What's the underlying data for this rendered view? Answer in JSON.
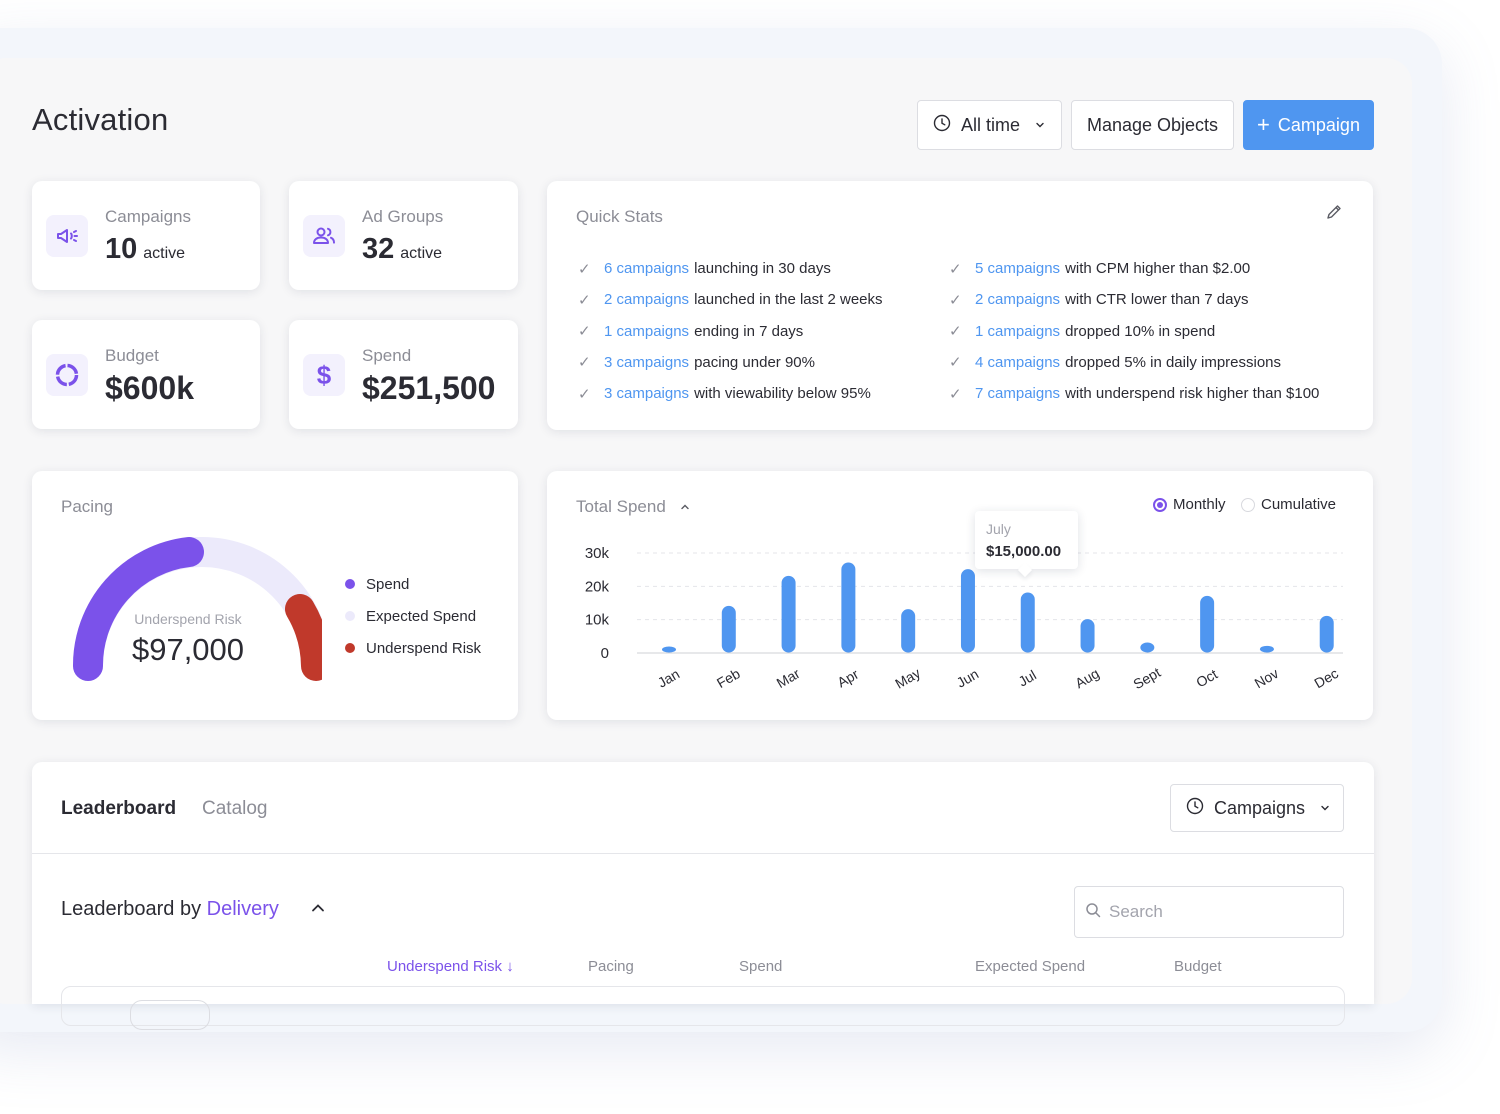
{
  "page": {
    "title": "Activation"
  },
  "toolbar": {
    "time_filter": "All time",
    "manage_objects": "Manage Objects",
    "add_campaign": "Campaign"
  },
  "stats": {
    "campaigns": {
      "label": "Campaigns",
      "value": "10",
      "sub": "active"
    },
    "ad_groups": {
      "label": "Ad Groups",
      "value": "32",
      "sub": "active"
    },
    "budget": {
      "label": "Budget",
      "value": "$600k"
    },
    "spend": {
      "label": "Spend",
      "value": "$251,500"
    }
  },
  "quick_stats": {
    "title": "Quick Stats",
    "left": [
      {
        "link": "6 campaigns",
        "text": "launching in 30 days"
      },
      {
        "link": "2 campaigns",
        "text": "launched in the last 2 weeks"
      },
      {
        "link": "1 campaigns",
        "text": "ending in 7 days"
      },
      {
        "link": "3 campaigns",
        "text": "pacing under 90%"
      },
      {
        "link": "3 campaigns",
        "text": "with viewability below 95%"
      }
    ],
    "right": [
      {
        "link": "5 campaigns",
        "text": "with CPM higher than $2.00"
      },
      {
        "link": "2 campaigns",
        "text": "with CTR lower than 7 days"
      },
      {
        "link": "1 campaigns",
        "text": "dropped 10% in spend"
      },
      {
        "link": "4 campaigns",
        "text": "dropped 5% in daily impressions"
      },
      {
        "link": "7 campaigns",
        "text": "with underspend risk higher than $100"
      }
    ]
  },
  "pacing": {
    "title": "Pacing",
    "center_label": "Underspend Risk",
    "center_value": "$97,000",
    "legend": [
      {
        "label": "Spend",
        "color": "#7b52ea"
      },
      {
        "label": "Expected Spend",
        "color": "#eceafb"
      },
      {
        "label": "Underspend Risk",
        "color": "#c0392b"
      }
    ]
  },
  "total_spend": {
    "title": "Total Spend",
    "toggle_monthly": "Monthly",
    "toggle_cumulative": "Cumulative",
    "tooltip_month": "July",
    "tooltip_value": "$15,000.00"
  },
  "chart_data": {
    "type": "bar",
    "categories": [
      "Jan",
      "Feb",
      "Mar",
      "Apr",
      "May",
      "Jun",
      "Jul",
      "Aug",
      "Sept",
      "Oct",
      "Nov",
      "Dec"
    ],
    "values": [
      1000,
      14000,
      23000,
      27000,
      13000,
      25000,
      18000,
      10000,
      3000,
      17000,
      2000,
      11000
    ],
    "y_ticks": [
      "30k",
      "20k",
      "10k",
      "0"
    ],
    "ylim": [
      0,
      30000
    ],
    "grid": true,
    "color": "#4f96f0"
  },
  "leaderboard": {
    "tab_leaderboard": "Leaderboard",
    "tab_catalog": "Catalog",
    "dropdown": "Campaigns",
    "title_prefix": "Leaderboard by",
    "title_accent": "Delivery",
    "search_placeholder": "Search",
    "columns": [
      "Underspend Risk",
      "Pacing",
      "Spend",
      "Expected Spend",
      "Budget"
    ]
  }
}
